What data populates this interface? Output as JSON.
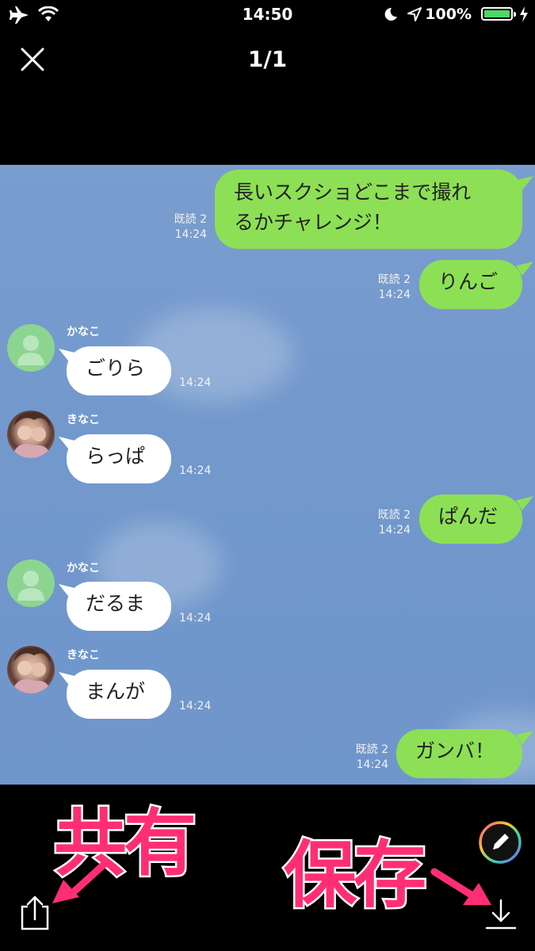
{
  "status_bar": {
    "time": "14:50",
    "battery_percent": "100%",
    "battery_level": 1.0,
    "icons": [
      "airplane-icon",
      "wifi-icon",
      "moon-icon",
      "location-icon",
      "battery-icon",
      "charging-icon"
    ]
  },
  "header": {
    "page_indicator": "1/1",
    "close_icon": "close-icon"
  },
  "messages": [
    {
      "side": "me",
      "text_line1": "長いスクショどこまで撮れ",
      "text_line2": "るかチャレンジ！",
      "read": "既読 2",
      "time": "14:24"
    },
    {
      "side": "me",
      "text": "りんご",
      "read": "既読 2",
      "time": "14:24"
    },
    {
      "side": "them",
      "name": "かなこ",
      "text": "ごりら",
      "time": "14:24"
    },
    {
      "side": "them",
      "name": "きなこ",
      "text": "らっぱ",
      "time": "14:24"
    },
    {
      "side": "me",
      "text": "ぱんだ",
      "read": "既読 2",
      "time": "14:24"
    },
    {
      "side": "them",
      "name": "かなこ",
      "text": "だるま",
      "time": "14:24"
    },
    {
      "side": "them",
      "name": "きなこ",
      "text": "まんが",
      "time": "14:24"
    },
    {
      "side": "me",
      "text": "ガンバ！",
      "read": "既読 2",
      "time": "14:24"
    }
  ],
  "overlay": {
    "share_label": "共有",
    "save_label": "保存",
    "accent_color": "#ff2e74"
  },
  "toolbar": {
    "share_icon": "share-icon",
    "edit_icon": "pencil-icon",
    "save_icon": "download-icon"
  }
}
